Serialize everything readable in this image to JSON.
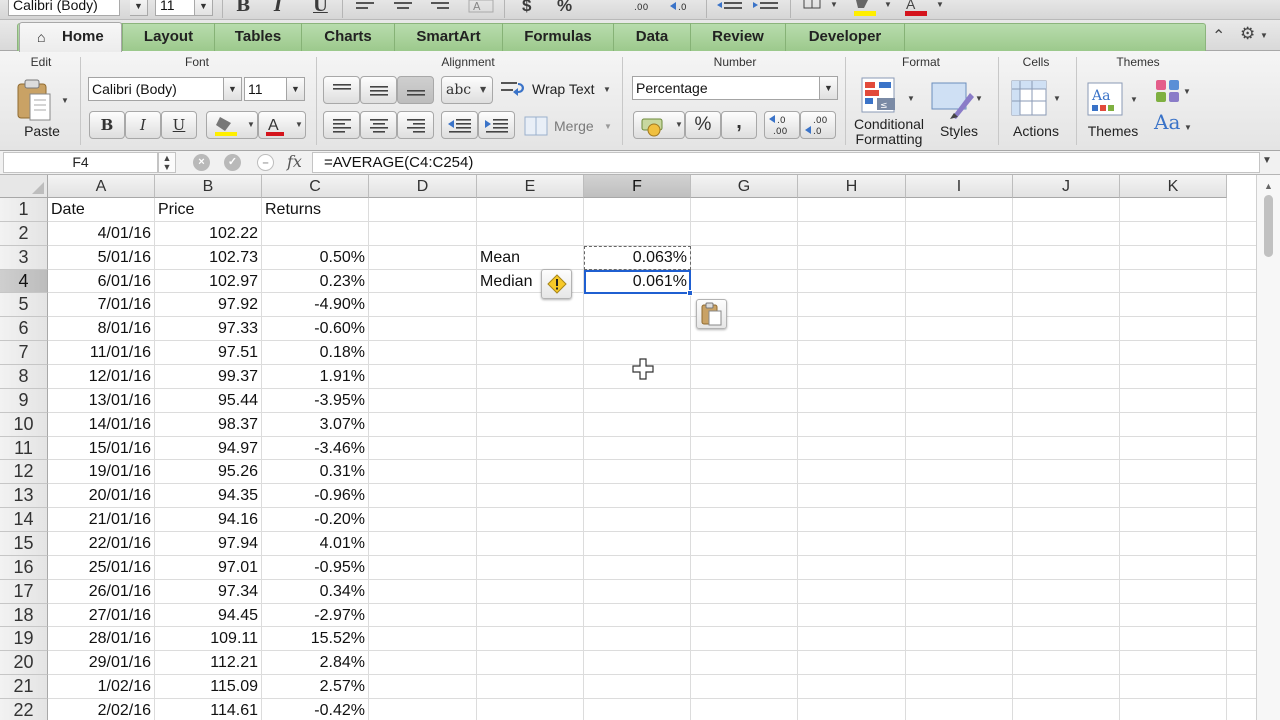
{
  "quick_toolbar": {
    "font_name": "Calibri (Body)",
    "font_size": "11",
    "icons": [
      "bold-icon",
      "italic-icon",
      "underline-icon",
      "align-left-icon",
      "align-center-icon",
      "text-shrink-icon",
      "currency-icon",
      "percent-icon",
      "increase-decimal-icon",
      "decrease-decimal-icon",
      "outdent-icon",
      "indent-icon",
      "borders-icon",
      "fill-color-icon",
      "font-color-icon"
    ]
  },
  "tabs": [
    "Home",
    "Layout",
    "Tables",
    "Charts",
    "SmartArt",
    "Formulas",
    "Data",
    "Review",
    "Developer"
  ],
  "ribbon": {
    "edit": {
      "title": "Edit",
      "paste_label": "Paste"
    },
    "font": {
      "title": "Font",
      "font_name": "Calibri (Body)",
      "font_size": "11",
      "bold": "B",
      "italic": "I",
      "underline": "U"
    },
    "alignment": {
      "title": "Alignment",
      "orientation_label": "abc",
      "wrap_text": "Wrap Text",
      "merge": "Merge"
    },
    "number": {
      "title": "Number",
      "format_value": "Percentage",
      "percent": "%",
      "comma": ","
    },
    "format": {
      "title": "Format",
      "conditional_line1": "Conditional",
      "conditional_line2": "Formatting",
      "styles": "Styles"
    },
    "cells": {
      "title": "Cells",
      "actions": "Actions"
    },
    "themes": {
      "title": "Themes",
      "themes": "Themes",
      "aa": "Aa"
    }
  },
  "formula_bar": {
    "name_box": "F4",
    "fx": "fx",
    "formula": "=AVERAGE(C4:C254)"
  },
  "grid": {
    "columns": [
      "A",
      "B",
      "C",
      "D",
      "E",
      "F",
      "G",
      "H",
      "I",
      "J",
      "K"
    ],
    "selected_column": "F",
    "selected_row": "4",
    "rows": [
      {
        "n": "1",
        "a": "Date",
        "b": "Price",
        "c": "Returns"
      },
      {
        "n": "2",
        "a": "4/01/16",
        "b": "102.22",
        "c": ""
      },
      {
        "n": "3",
        "a": "5/01/16",
        "b": "102.73",
        "c": "0.50%"
      },
      {
        "n": "4",
        "a": "6/01/16",
        "b": "102.97",
        "c": "0.23%"
      },
      {
        "n": "5",
        "a": "7/01/16",
        "b": "97.92",
        "c": "-4.90%"
      },
      {
        "n": "6",
        "a": "8/01/16",
        "b": "97.33",
        "c": "-0.60%"
      },
      {
        "n": "7",
        "a": "11/01/16",
        "b": "97.51",
        "c": "0.18%"
      },
      {
        "n": "8",
        "a": "12/01/16",
        "b": "99.37",
        "c": "1.91%"
      },
      {
        "n": "9",
        "a": "13/01/16",
        "b": "95.44",
        "c": "-3.95%"
      },
      {
        "n": "10",
        "a": "14/01/16",
        "b": "98.37",
        "c": "3.07%"
      },
      {
        "n": "11",
        "a": "15/01/16",
        "b": "94.97",
        "c": "-3.46%"
      },
      {
        "n": "12",
        "a": "19/01/16",
        "b": "95.26",
        "c": "0.31%"
      },
      {
        "n": "13",
        "a": "20/01/16",
        "b": "94.35",
        "c": "-0.96%"
      },
      {
        "n": "14",
        "a": "21/01/16",
        "b": "94.16",
        "c": "-0.20%"
      },
      {
        "n": "15",
        "a": "22/01/16",
        "b": "97.94",
        "c": "4.01%"
      },
      {
        "n": "16",
        "a": "25/01/16",
        "b": "97.01",
        "c": "-0.95%"
      },
      {
        "n": "17",
        "a": "26/01/16",
        "b": "97.34",
        "c": "0.34%"
      },
      {
        "n": "18",
        "a": "27/01/16",
        "b": "94.45",
        "c": "-2.97%"
      },
      {
        "n": "19",
        "a": "28/01/16",
        "b": "109.11",
        "c": "15.52%"
      },
      {
        "n": "20",
        "a": "29/01/16",
        "b": "112.21",
        "c": "2.84%"
      },
      {
        "n": "21",
        "a": "1/02/16",
        "b": "115.09",
        "c": "2.57%"
      },
      {
        "n": "22",
        "a": "2/02/16",
        "b": "114.61",
        "c": "-0.42%"
      }
    ],
    "stats": {
      "mean_label": "Mean",
      "mean_value": "0.063%",
      "median_label": "Median",
      "median_value": "0.061%"
    }
  }
}
